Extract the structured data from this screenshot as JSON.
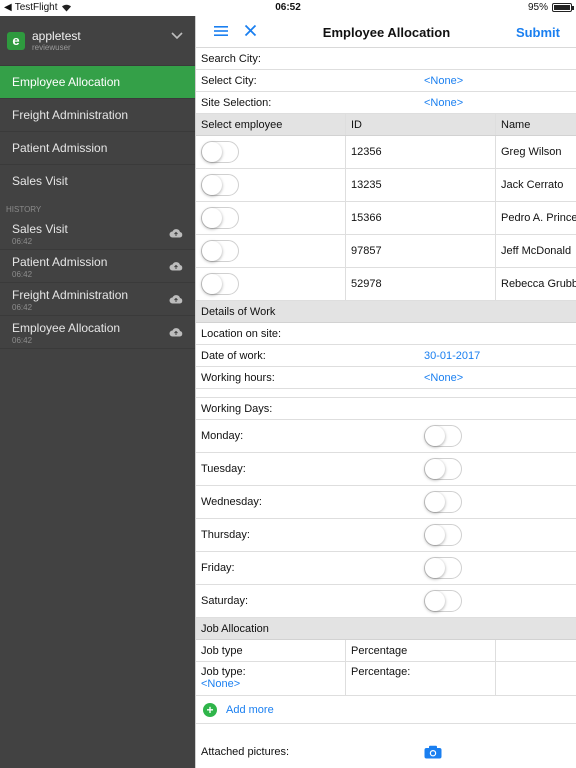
{
  "statusbar": {
    "carrier": "TestFlight",
    "time": "06:52",
    "battery": "95%"
  },
  "sidebar": {
    "user": {
      "name": "appletest",
      "sub": "reviewuser"
    },
    "nav": [
      {
        "label": "Employee Allocation",
        "active": true
      },
      {
        "label": "Freight Administration"
      },
      {
        "label": "Patient Admission"
      },
      {
        "label": "Sales Visit"
      }
    ],
    "history_label": "HISTORY",
    "history": [
      {
        "title": "Sales Visit",
        "time": "06:42"
      },
      {
        "title": "Patient Admission",
        "time": "06:42"
      },
      {
        "title": "Freight Administration",
        "time": "06:42"
      },
      {
        "title": "Employee Allocation",
        "time": "06:42"
      }
    ]
  },
  "header": {
    "title": "Employee Allocation",
    "submit": "Submit"
  },
  "form": {
    "search_city": "Search City:",
    "select_city": {
      "label": "Select City:",
      "value": "<None>"
    },
    "site_selection": {
      "label": "Site Selection:",
      "value": "<None>"
    },
    "employee_table": {
      "headers": [
        "Select employee",
        "ID",
        "Name"
      ],
      "rows": [
        {
          "id": "12356",
          "name": "Greg Wilson"
        },
        {
          "id": "13235",
          "name": "Jack Cerrato"
        },
        {
          "id": "15366",
          "name": "Pedro A. Prince"
        },
        {
          "id": "97857",
          "name": "Jeff McDonald"
        },
        {
          "id": "52978",
          "name": "Rebecca Grubbs"
        }
      ]
    },
    "details_header": "Details of Work",
    "location": "Location on site:",
    "date_of_work": {
      "label": "Date of work:",
      "value": "30-01-2017"
    },
    "working_hours": {
      "label": "Working hours:",
      "value": "<None>"
    },
    "working_days_label": "Working Days:",
    "days": [
      "Monday:",
      "Tuesday:",
      "Wednesday:",
      "Thursday:",
      "Friday:",
      "Saturday:"
    ],
    "job_header": "Job Allocation",
    "job_columns": [
      "Job type",
      "Percentage"
    ],
    "job_row": {
      "job_type_label": "Job type:",
      "job_type_value": "<None>",
      "percentage_label": "Percentage:"
    },
    "add_more": "Add more",
    "attached_pictures": "Attached pictures:"
  },
  "colors": {
    "accent": "#1a7ff0",
    "active_nav": "#34a048",
    "sidebar_bg": "#424242"
  },
  "icons": [
    "wifi-icon",
    "chevron-down-icon",
    "cloud-upload-icon",
    "hamburger-icon",
    "close-icon",
    "plus-circle-icon",
    "camera-icon"
  ]
}
